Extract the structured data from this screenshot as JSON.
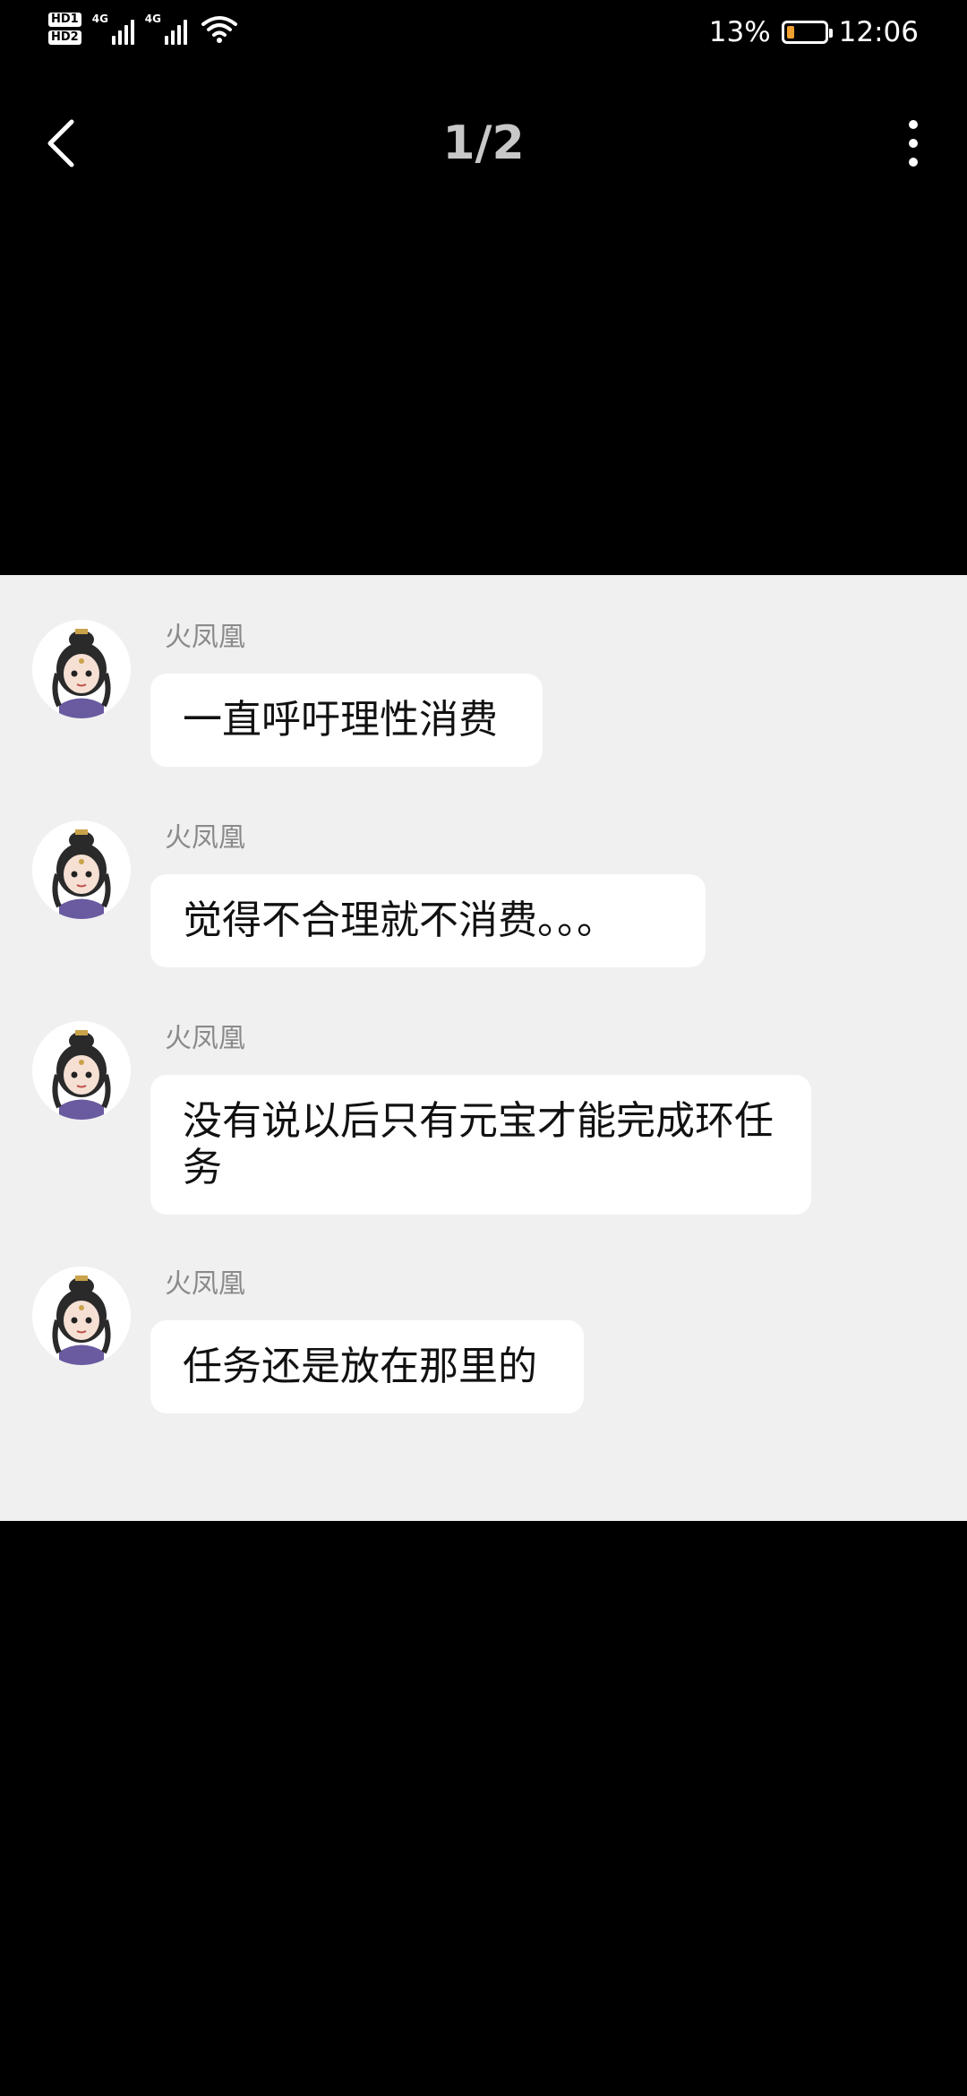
{
  "status_bar": {
    "hd1": "HD1",
    "hd2": "HD2",
    "net1": "4G",
    "net2": "4G",
    "battery_percent": "13%",
    "battery_level": 0.13,
    "battery_color": "#f0a030",
    "time": "12:06"
  },
  "nav": {
    "back_icon": "chevron-left-icon",
    "page_counter": "1/2",
    "more_icon": "more-vertical-icon"
  },
  "messages": [
    {
      "sender": "火凤凰",
      "text": "一直呼吁理性消费"
    },
    {
      "sender": "火凤凰",
      "text": "觉得不合理就不消费。。。"
    },
    {
      "sender": "火凤凰",
      "text": "没有说以后只有元宝才能完成环任务"
    },
    {
      "sender": "火凤凰",
      "text": "任务还是放在那里的"
    }
  ],
  "colors": {
    "background": "#000000",
    "chat_panel": "#f0f0f0",
    "bubble": "#ffffff",
    "sender_text": "#8a8a8a",
    "page_counter": "#c8c8c8"
  }
}
